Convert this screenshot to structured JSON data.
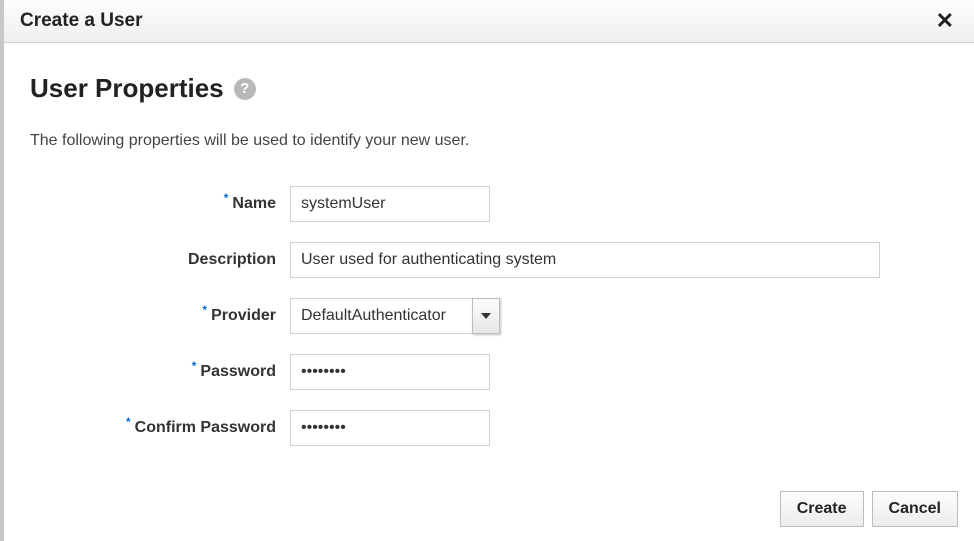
{
  "dialog": {
    "title": "Create a User",
    "close_label": "✕"
  },
  "section": {
    "heading": "User Properties",
    "help_symbol": "?",
    "description": "The following properties will be used to identify your new user."
  },
  "form": {
    "required_marker": "*",
    "name": {
      "label": "Name",
      "value": "systemUser"
    },
    "description": {
      "label": "Description",
      "value": "User used for authenticating system"
    },
    "provider": {
      "label": "Provider",
      "value": "DefaultAuthenticator"
    },
    "password": {
      "label": "Password",
      "value": "••••••••"
    },
    "confirm_password": {
      "label": "Confirm Password",
      "value": "••••••••"
    }
  },
  "footer": {
    "create_label": "Create",
    "cancel_label": "Cancel"
  }
}
